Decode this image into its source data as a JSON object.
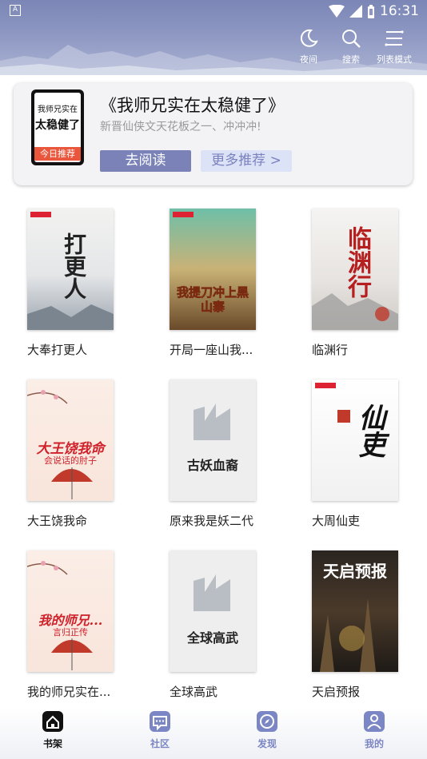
{
  "status": {
    "badge": "A",
    "time": "16:31"
  },
  "header": {
    "night_label": "夜间",
    "search_label": "搜索",
    "list_mode_label": "列表模式"
  },
  "featured": {
    "title": "《我师兄实在太稳健了》",
    "subtitle": "新晋仙侠文天花板之一、冲冲冲!",
    "cover_line1": "我师兄实在",
    "cover_line2": "太稳健了",
    "cover_badge": "今日推荐",
    "read_button": "去阅读",
    "more_button": "更多推荐 >"
  },
  "books": [
    {
      "title": "大奉打更人",
      "cover_text": "打更人"
    },
    {
      "title": "开局一座山我...",
      "cover_text": "我提刀冲上黑山寨"
    },
    {
      "title": "临渊行",
      "cover_text": "临渊行"
    },
    {
      "title": "大王饶我命",
      "cover_text": "大王饶我命",
      "cover_sub": "会说话的肘子"
    },
    {
      "title": "原来我是妖二代",
      "cover_text": "古妖血裔"
    },
    {
      "title": "大周仙吏",
      "cover_text": "仙吏"
    },
    {
      "title": "我的师兄实在...",
      "cover_text": "我的师兄...",
      "cover_sub": "言归正传"
    },
    {
      "title": "全球高武",
      "cover_text": "全球高武"
    },
    {
      "title": "天启预报",
      "cover_text": "天启预报"
    }
  ],
  "nav": {
    "shelf": "书架",
    "community": "社区",
    "discover": "发现",
    "mine": "我的"
  },
  "colors": {
    "header": "#8d97c2",
    "accent": "#7a82b8",
    "badge_red": "#e9563b",
    "nav_active": "#111111",
    "nav_inactive": "#7b86c4"
  }
}
